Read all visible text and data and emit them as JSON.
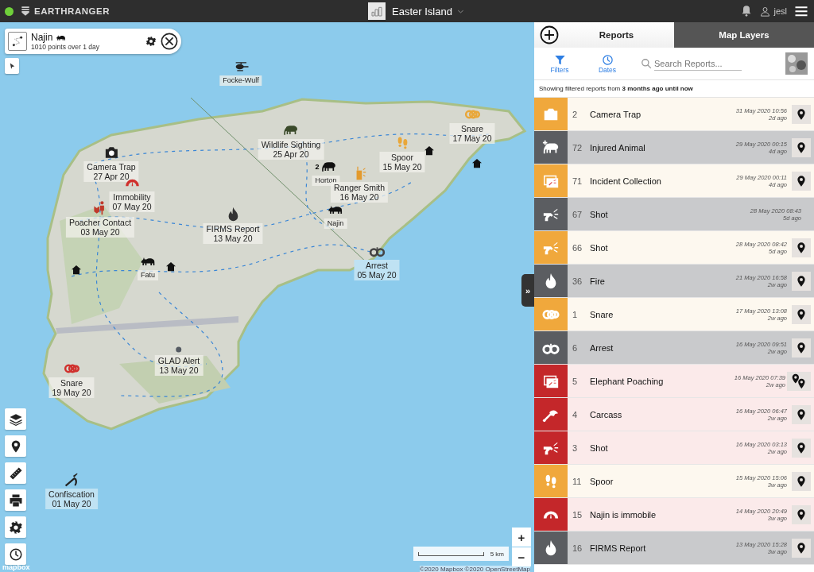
{
  "top_bar": {
    "online": true,
    "brand": "EARTHRANGER",
    "map_name": "Easter Island",
    "user": "jesl"
  },
  "track_card": {
    "name": "Najin",
    "summary": "1010 points over 1 day"
  },
  "map": {
    "markers": [
      {
        "kind": "helicopter",
        "name": "Focke-Wulf",
        "color": "#222222",
        "selected": false
      },
      {
        "kind": "elephant",
        "name": "Wildlife Sighting",
        "date": "25 Apr 20",
        "color": "#3a4a2a",
        "selected": false
      },
      {
        "kind": "camera",
        "name": "Camera Trap",
        "date": "27 Apr 20",
        "color": "#222222",
        "selected": false
      },
      {
        "kind": "gauge",
        "name": "Immobility",
        "date": "07 May 20",
        "color": "#d0312d",
        "selected": false
      },
      {
        "kind": "person",
        "name": "Poacher Contact",
        "date": "03 May 20",
        "color": "#c0392b",
        "selected": false
      },
      {
        "kind": "flame",
        "name": "FIRMS Report",
        "date": "13 May 20",
        "color": "#333333",
        "selected": false
      },
      {
        "kind": "elephant",
        "name": "Horton",
        "badge": "2",
        "color": "#111111",
        "selected": false
      },
      {
        "kind": "radio",
        "name": "Ranger Smith",
        "date": "16 May 20",
        "color": "#e39a2d",
        "selected": false
      },
      {
        "kind": "footprints",
        "name": "Spoor",
        "date": "15 May 20",
        "color": "#e9a73a",
        "selected": false
      },
      {
        "kind": "snare",
        "name": "Snare",
        "date": "17 May 20",
        "color": "#e9a73a",
        "selected": false
      },
      {
        "kind": "rhino",
        "name": "Najin",
        "color": "#111111",
        "selected": false
      },
      {
        "kind": "rhino",
        "name": "Fatu",
        "color": "#111111",
        "selected": false
      },
      {
        "kind": "handcuffs",
        "name": "Arrest",
        "date": "05 May 20",
        "color": "#444444",
        "selected": true
      },
      {
        "kind": "dot",
        "name": "GLAD Alert",
        "date": "13 May 20",
        "color": "#555b63",
        "selected": false
      },
      {
        "kind": "snare",
        "name": "Snare",
        "date": "19 May 20",
        "color": "#d0312d",
        "selected": false
      },
      {
        "kind": "rifle",
        "name": "Confiscation",
        "date": "01 May 20",
        "color": "#222222",
        "selected": true
      }
    ]
  },
  "map_controls": {
    "zoom_in": "+",
    "zoom_out": "−",
    "scale": "5 km",
    "attribution": "©2020 Mapbox ©2020 OpenStreetMap",
    "logo": "mapbox",
    "collapse": "»"
  },
  "panel": {
    "tabs": [
      {
        "label": "Reports",
        "selected": true
      },
      {
        "label": "Map Layers",
        "selected": false
      }
    ],
    "filters": "Filters",
    "dates": "Dates",
    "search": {
      "placeholder": "Search Reports..."
    },
    "filter_note": "Showing filtered reports from **3 months ago until now**",
    "reports": [
      {
        "kind": "camera",
        "color": "#f0a83c",
        "number": "2",
        "title": "Camera Trap",
        "time": "31 May 2020 10:56",
        "age": "2d ago",
        "has_location": true,
        "multiple_locations": false
      },
      {
        "kind": "injured",
        "color": "#5b5d61",
        "number": "72",
        "title": "Injured Animal",
        "time": "29 May 2020 00:15",
        "age": "4d ago",
        "has_location": true,
        "multiple_locations": false
      },
      {
        "kind": "collection",
        "color": "#f0a83c",
        "number": "71",
        "title": "Incident Collection",
        "time": "29 May 2020 00:11",
        "age": "4d ago",
        "has_location": true,
        "multiple_locations": false
      },
      {
        "kind": "shot",
        "color": "#5b5d61",
        "number": "67",
        "title": "Shot",
        "time": "28 May 2020 08:43",
        "age": "5d ago",
        "has_location": false
      },
      {
        "kind": "shot",
        "color": "#f0a83c",
        "number": "66",
        "title": "Shot",
        "time": "28 May 2020 08:42",
        "age": "5d ago",
        "has_location": true,
        "multiple_locations": false
      },
      {
        "kind": "flame",
        "color": "#5b5d61",
        "number": "36",
        "title": "Fire",
        "time": "21 May 2020 16:58",
        "age": "2w ago",
        "has_location": true,
        "multiple_locations": false
      },
      {
        "kind": "snare",
        "color": "#f0a83c",
        "number": "1",
        "title": "Snare",
        "time": "17 May 2020 13:08",
        "age": "2w ago",
        "has_location": true,
        "multiple_locations": false
      },
      {
        "kind": "handcuffs",
        "color": "#5b5d61",
        "number": "6",
        "title": "Arrest",
        "time": "16 May 2020 09:51",
        "age": "2w ago",
        "has_location": true,
        "multiple_locations": false
      },
      {
        "kind": "collection",
        "color": "#c4272a",
        "number": "5",
        "title": "Elephant Poaching",
        "time": "16 May 2020 07:39",
        "age": "2w ago",
        "has_location": true,
        "multiple_locations": true
      },
      {
        "kind": "carcass",
        "color": "#c4272a",
        "number": "4",
        "title": "Carcass",
        "time": "16 May 2020 06:47",
        "age": "2w ago",
        "has_location": true,
        "multiple_locations": false
      },
      {
        "kind": "shot",
        "color": "#c4272a",
        "number": "3",
        "title": "Shot",
        "time": "16 May 2020 03:13",
        "age": "2w ago",
        "has_location": true,
        "multiple_locations": false
      },
      {
        "kind": "footprints",
        "color": "#f0a83c",
        "number": "11",
        "title": "Spoor",
        "time": "15 May 2020 15:06",
        "age": "3w ago",
        "has_location": true,
        "multiple_locations": false
      },
      {
        "kind": "gauge",
        "color": "#c4272a",
        "number": "15",
        "title": "Najin is immobile",
        "time": "14 May 2020 20:49",
        "age": "3w ago",
        "has_location": true,
        "multiple_locations": false
      },
      {
        "kind": "flame",
        "color": "#5b5d61",
        "number": "16",
        "title": "FIRMS Report",
        "time": "13 May 2020 15:28",
        "age": "3w ago",
        "has_location": true,
        "multiple_locations": false
      }
    ]
  }
}
